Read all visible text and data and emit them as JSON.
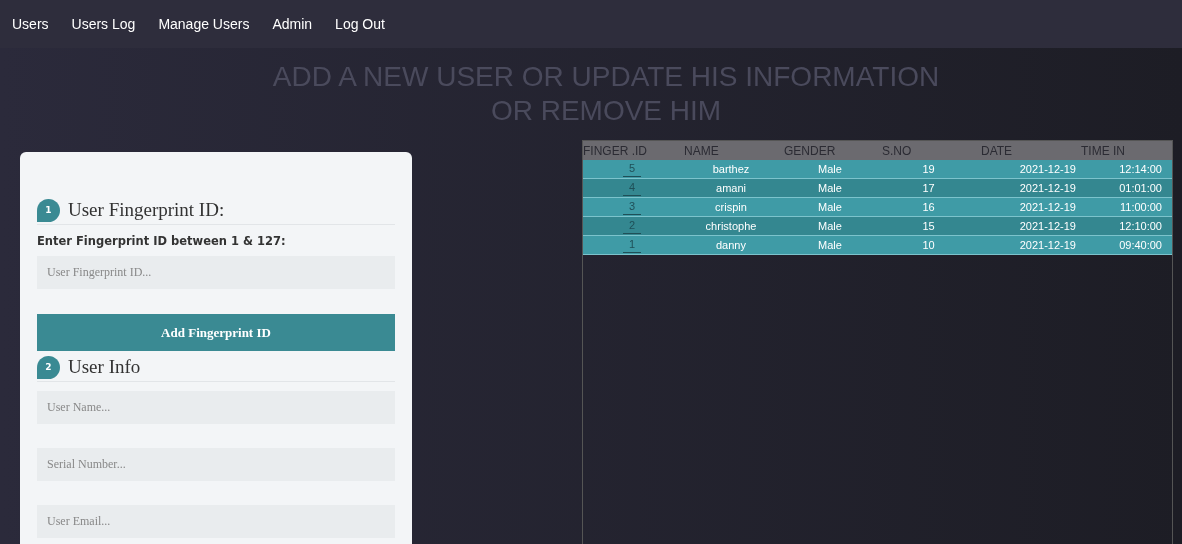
{
  "nav": [
    {
      "label": "Users"
    },
    {
      "label": "Users Log"
    },
    {
      "label": "Manage Users"
    },
    {
      "label": "Admin"
    },
    {
      "label": "Log Out"
    }
  ],
  "heading": [
    "ADD A NEW USER OR UPDATE HIS INFORMATION",
    "OR REMOVE HIM"
  ],
  "form": {
    "sections": [
      {
        "number": "1",
        "title": "User Fingerprint ID:",
        "label": "Enter Fingerprint ID between 1 & 127:",
        "fields": [
          {
            "placeholder": "User Fingerprint ID..."
          }
        ],
        "button": "Add Fingerprint ID"
      },
      {
        "number": "2",
        "title": "User Info",
        "fields": [
          {
            "placeholder": "User Name..."
          },
          {
            "placeholder": "Serial Number..."
          },
          {
            "placeholder": "User Email..."
          }
        ]
      }
    ]
  },
  "table": {
    "columns": [
      "FINGER .ID",
      "NAME",
      "GENDER",
      "S.NO",
      "DATE",
      "TIME IN"
    ],
    "rows": [
      [
        "5",
        "barthez",
        "Male",
        "19",
        "2021-12-19",
        "12:14:00"
      ],
      [
        "4",
        "amani",
        "Male",
        "17",
        "2021-12-19",
        "01:01:00"
      ],
      [
        "3",
        "crispin",
        "Male",
        "16",
        "2021-12-19",
        "11:00:00"
      ],
      [
        "2",
        "christophe",
        "Male",
        "15",
        "2021-12-19",
        "12:10:00"
      ],
      [
        "1",
        "danny",
        "Male",
        "10",
        "2021-12-19",
        "09:40:00"
      ]
    ]
  }
}
